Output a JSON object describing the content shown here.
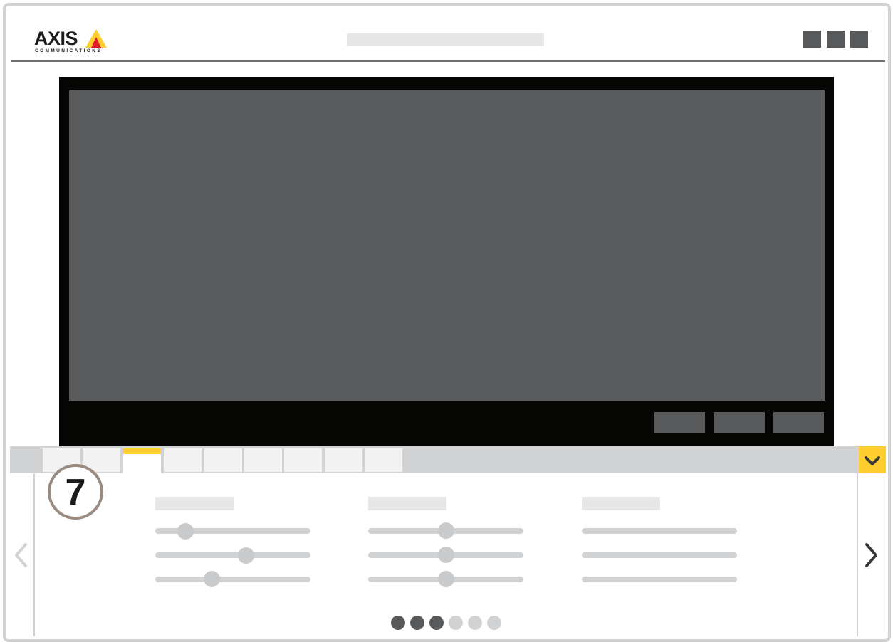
{
  "header": {
    "logo": {
      "wordmark": "AXIS",
      "tagline": "COMMUNICATIONS",
      "accent_colors": [
        "#ffcd2e",
        "#e21e25"
      ]
    },
    "title_placeholder": "",
    "buttons": [
      "menu-button-1",
      "menu-button-2",
      "menu-button-3"
    ]
  },
  "video": {
    "controls": [
      "video-control-1",
      "video-control-2",
      "video-control-3"
    ]
  },
  "tabs": {
    "count": 9,
    "active_index": 2,
    "accent_color": "#ffcd2e",
    "collapse_icon": "chevron-down-icon"
  },
  "panel": {
    "step_number": "7",
    "groups": [
      {
        "name": "group-1",
        "type": "sliders",
        "levels": [
          0.2,
          0.59,
          0.36
        ]
      },
      {
        "name": "group-2",
        "type": "sliders",
        "levels": [
          0.5,
          0.5,
          0.5
        ]
      },
      {
        "name": "group-3",
        "type": "lines"
      }
    ],
    "pagination": {
      "total": 6,
      "current": 3
    },
    "prev_icon": "chevron-left-icon",
    "next_icon": "chevron-right-icon"
  }
}
